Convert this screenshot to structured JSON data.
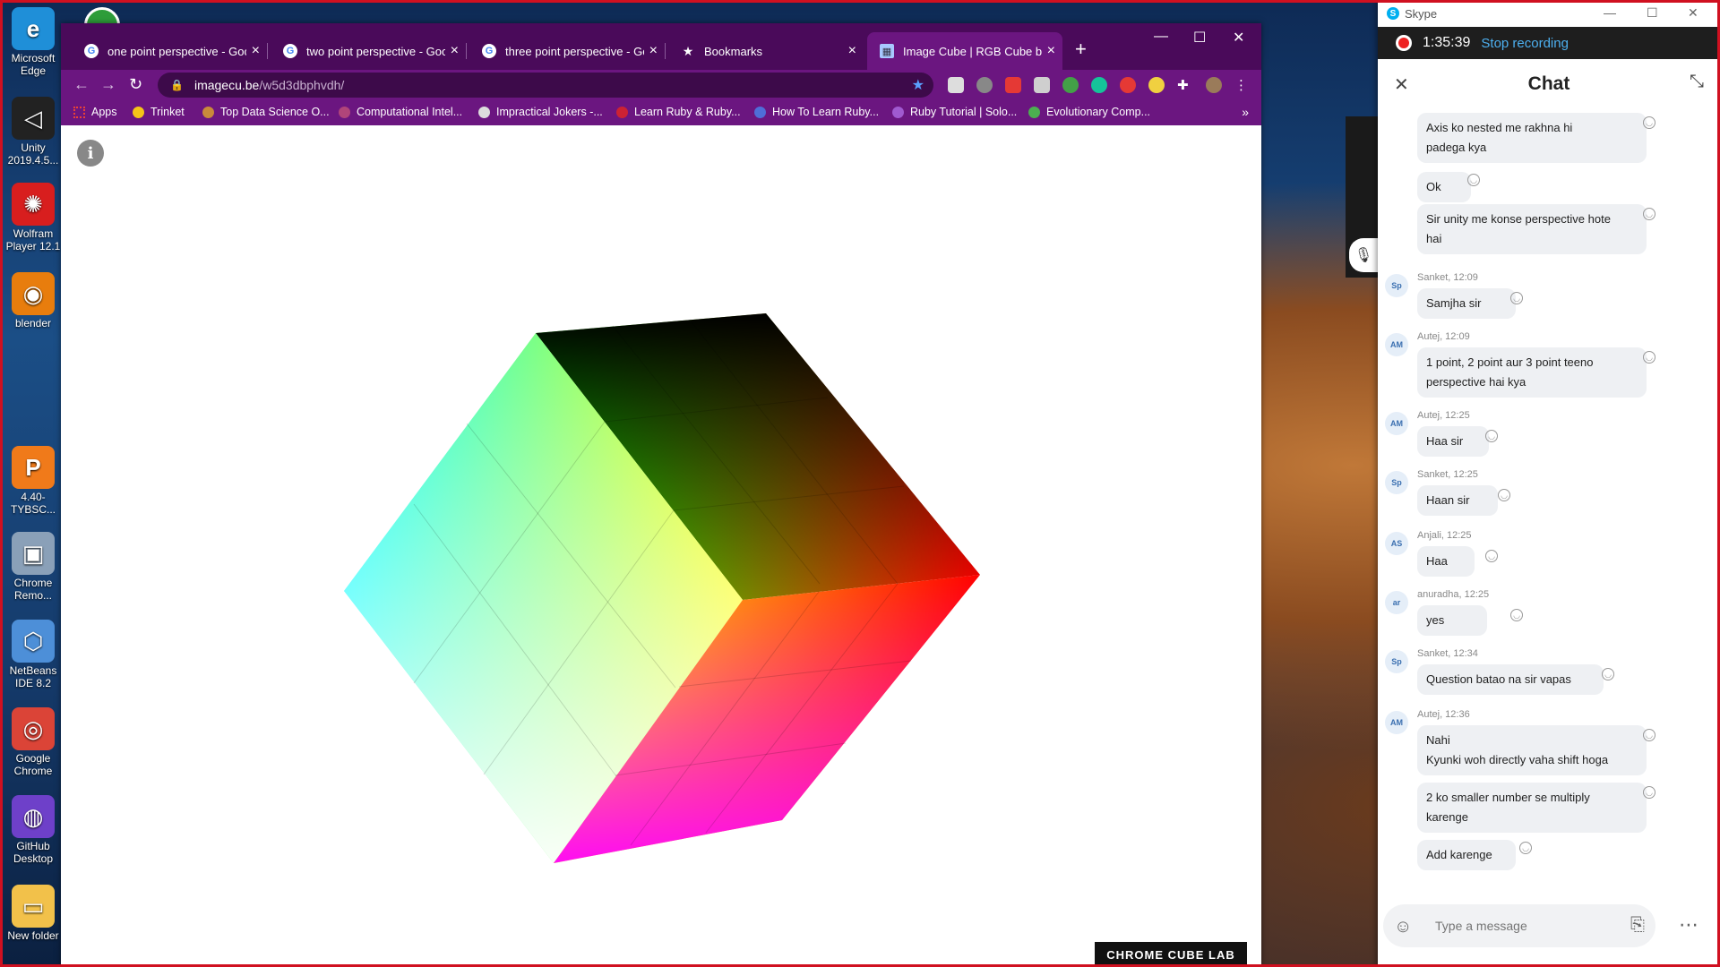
{
  "desktop": {
    "icons": [
      {
        "name": "edge-icon",
        "label": "Microsoft Edge",
        "color": "#1f8fd8",
        "glyph": "e"
      },
      {
        "name": "unity-icon",
        "label": "Unity 2019.4.5...",
        "color": "#222222",
        "glyph": "◁"
      },
      {
        "name": "wolfram-icon",
        "label": "Wolfram Player 12.1",
        "color": "#d81e1e",
        "glyph": "✺"
      },
      {
        "name": "blender-icon",
        "label": "blender",
        "color": "#e87d0d",
        "glyph": "◉"
      },
      {
        "name": "pdf-icon",
        "label": "4.40-TYBSC...",
        "color": "#f07a1a",
        "glyph": "P"
      },
      {
        "name": "chrome-remote-icon",
        "label": "Chrome Remo...",
        "color": "#8aa0b8",
        "glyph": "▣"
      },
      {
        "name": "netbeans-icon",
        "label": "NetBeans IDE 8.2",
        "color": "#4d8fd8",
        "glyph": "⬡"
      },
      {
        "name": "google-chrome-icon",
        "label": "Google Chrome",
        "color": "#db4437",
        "glyph": "◎"
      },
      {
        "name": "github-desktop-icon",
        "label": "GitHub Desktop",
        "color": "#6e40c9",
        "glyph": "◍"
      },
      {
        "name": "folder-icon",
        "label": "New folder",
        "color": "#f2c14a",
        "glyph": "▭"
      }
    ]
  },
  "browser": {
    "tabs": [
      {
        "title": "one point perspective - Goog",
        "active": false
      },
      {
        "title": "two point perspective - Goog",
        "active": false
      },
      {
        "title": "three point perspective - Goo",
        "active": false
      },
      {
        "title": "Bookmarks",
        "active": false
      },
      {
        "title": "Image Cube | RGB Cube by G",
        "active": true
      }
    ],
    "url_host": "imagecu.be",
    "url_path": "/w5d3dbphvdh/",
    "bookmarks": [
      {
        "label": "Apps",
        "color": "#ea4335"
      },
      {
        "label": "Trinket",
        "color": "#f5c518"
      },
      {
        "label": "Top Data Science O...",
        "color": "#c98a3a"
      },
      {
        "label": "Computational Intel...",
        "color": "#b0457a"
      },
      {
        "label": "Impractical Jokers -...",
        "color": "#dddddd"
      },
      {
        "label": "Learn Ruby & Ruby...",
        "color": "#cc2233"
      },
      {
        "label": "How To Learn Ruby...",
        "color": "#4f6ed8"
      },
      {
        "label": "Ruby Tutorial | Solo...",
        "color": "#a05ad0"
      },
      {
        "label": "Evolutionary Comp...",
        "color": "#4caf50"
      }
    ],
    "page": {
      "info_glyph": "i",
      "badge": "CHROME CUBE LAB"
    }
  },
  "skype": {
    "app_name": "Skype",
    "recording_time": "1:35:39",
    "stop_label": "Stop recording",
    "chat_title": "Chat",
    "composer_placeholder": "Type a message",
    "messages": [
      {
        "sender": "",
        "initials": "",
        "lines": [
          "Axis ko nested me rakhna hi",
          "padega kya"
        ]
      },
      {
        "sender": "",
        "initials": "",
        "lines": [
          "Ok"
        ]
      },
      {
        "sender": "",
        "initials": "",
        "lines": [
          "Sir unity me konse perspective hote",
          "hai"
        ]
      },
      {
        "sender": "Sanket, 12:09",
        "initials": "Sp",
        "lines": [
          "Samjha sir"
        ]
      },
      {
        "sender": "Autej, 12:09",
        "initials": "AM",
        "lines": [
          "1 point, 2 point aur 3 point teeno",
          "perspective hai kya"
        ]
      },
      {
        "sender": "Autej, 12:25",
        "initials": "AM",
        "lines": [
          "Haa sir"
        ]
      },
      {
        "sender": "Sanket, 12:25",
        "initials": "Sp",
        "lines": [
          "Haan sir"
        ]
      },
      {
        "sender": "Anjali, 12:25",
        "initials": "AS",
        "lines": [
          "Haa"
        ]
      },
      {
        "sender": "anuradha, 12:25",
        "initials": "ar",
        "lines": [
          "yes"
        ]
      },
      {
        "sender": "Sanket, 12:34",
        "initials": "Sp",
        "lines": [
          "Question batao na sir vapas"
        ]
      },
      {
        "sender": "Autej, 12:36",
        "initials": "AM",
        "lines": [
          "Nahi",
          "Kyunki woh directly vaha shift hoga"
        ]
      },
      {
        "sender": "",
        "initials": "",
        "lines": [
          "2 ko smaller number se multiply",
          "karenge"
        ]
      },
      {
        "sender": "",
        "initials": "",
        "lines": [
          "Add karenge"
        ]
      }
    ]
  }
}
